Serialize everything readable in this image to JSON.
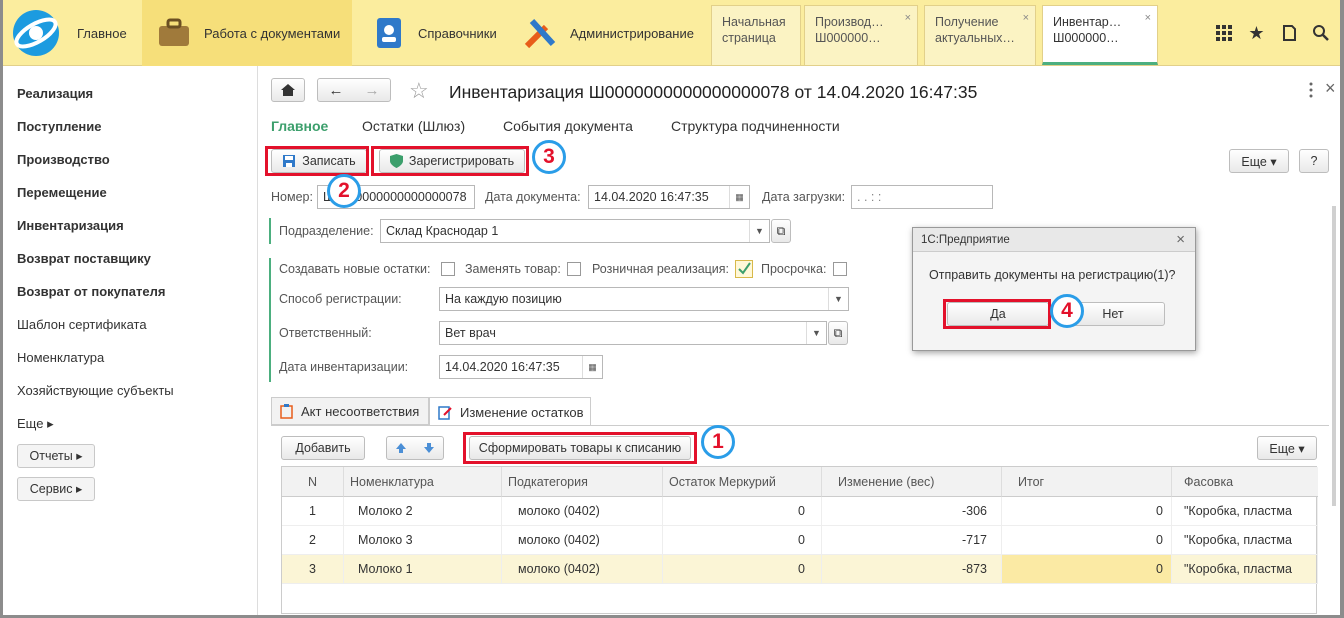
{
  "topbar": {
    "home": "Главное",
    "sections": [
      "Работа с документами",
      "Справочники",
      "Администрирование"
    ],
    "tabs": [
      {
        "line1": "Начальная",
        "line2": "страница"
      },
      {
        "line1": "Производ…",
        "line2": "Ш000000…"
      },
      {
        "line1": "Получение",
        "line2": "актуальных…"
      },
      {
        "line1": "Инвентар…",
        "line2": "Ш000000…"
      }
    ],
    "close_glyph": "×",
    "icons": {
      "grid": "⋮⋮⋮",
      "star": "★",
      "history": "⧉",
      "search": "⌕"
    }
  },
  "sidebar": {
    "items": [
      {
        "label": "Реализация",
        "bold": true
      },
      {
        "label": "Поступление",
        "bold": true
      },
      {
        "label": "Производство",
        "bold": true
      },
      {
        "label": "Перемещение",
        "bold": true
      },
      {
        "label": "Инвентаризация",
        "bold": true
      },
      {
        "label": "Возврат поставщику",
        "bold": true
      },
      {
        "label": "Возврат от покупателя",
        "bold": true
      },
      {
        "label": "Шаблон сертификата",
        "bold": false
      },
      {
        "label": "Номенклатура",
        "bold": false
      },
      {
        "label": "Хозяйствующие субъекты",
        "bold": false
      },
      {
        "label": "Еще ▸",
        "bold": false
      }
    ],
    "reports": "Отчеты ▸",
    "service": "Сервис ▸"
  },
  "doc": {
    "title": "Инвентаризация Ш0000000000000000078 от 14.04.2020 16:47:35",
    "nav": [
      "Главное",
      "Остатки (Шлюз)",
      "События документа",
      "Структура подчиненности"
    ],
    "save": "Записать",
    "register": "Зарегистрировать",
    "more": "Еще ▾",
    "help": "?",
    "number_label": "Номер:",
    "number_value": "Ш0000000000000000078",
    "date_label": "Дата документа:",
    "date_value": "14.04.2020 16:47:35",
    "load_label": "Дата загрузки:",
    "load_value": " .  .       :  :",
    "division_label": "Подразделение:",
    "division_value": "Склад Краснодар 1",
    "chk_new": "Создавать новые остатки:",
    "chk_replace": "Заменять товар:",
    "chk_retail": "Розничная реализация:",
    "chk_expired": "Просрочка:",
    "method_label": "Способ регистрации:",
    "method_value": "На каждую позицию",
    "resp_label": "Ответственный:",
    "resp_value": "Вет врач",
    "inv_date_label": "Дата инвентаризации:",
    "inv_date_value": "14.04.2020 16:47:35",
    "tabs": [
      "Акт несоответствия",
      "Изменение остатков"
    ],
    "add": "Добавить",
    "form": "Сформировать товары к списанию",
    "more2": "Еще ▾"
  },
  "table": {
    "headers": [
      "N",
      "Номенклатура",
      "Подкатегория",
      "Остаток Меркурий",
      "Изменение (вес)",
      "Итог",
      "Фасовка"
    ],
    "rows": [
      [
        "1",
        "Молоко 2",
        "молоко (0402)",
        "0",
        "-306",
        "0",
        "\"Коробка, пластма"
      ],
      [
        "2",
        "Молоко 3",
        "молоко (0402)",
        "0",
        "-717",
        "0",
        "\"Коробка, пластма"
      ],
      [
        "3",
        "Молоко 1",
        "молоко (0402)",
        "0",
        "-873",
        "0",
        "\"Коробка, пластма"
      ]
    ]
  },
  "dialog": {
    "title": "1С:Предприятие",
    "message": "Отправить документы на регистрацию(1)?",
    "yes": "Да",
    "no": "Нет"
  },
  "markers": [
    "1",
    "2",
    "3",
    "4"
  ],
  "colors": {
    "accent": "#4caf7f",
    "highlight": "#e3112b",
    "marker_ring": "#2a9de8",
    "topbar": "#fbed9e"
  }
}
